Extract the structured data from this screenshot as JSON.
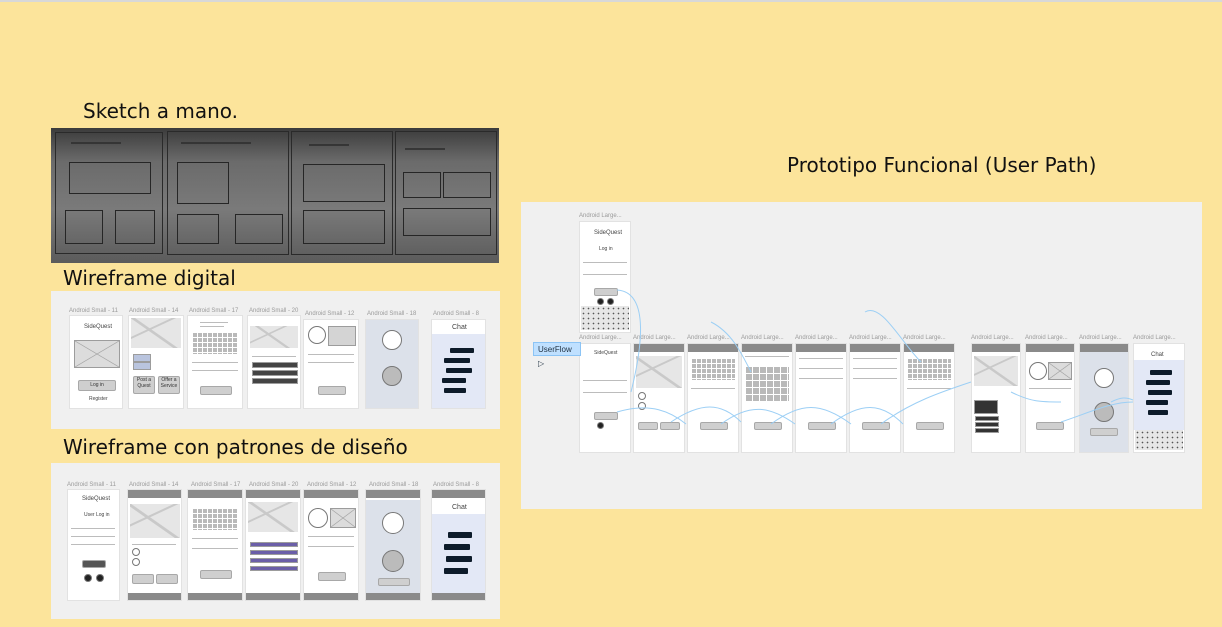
{
  "labels": {
    "sketch": "Sketch a mano.",
    "wireframe": "Wireframe digital",
    "patterns": "Wireframe con patrones de diseño",
    "prototype": "Prototipo Funcional (User Path)"
  },
  "prototype": {
    "user_flow_tag": "UserFlow",
    "frame_title": "Android Large...",
    "login": {
      "app_name": "SideQuest",
      "heading": "Log in",
      "button": "Log in"
    },
    "chat_title": "Chat"
  },
  "wireframe": {
    "frame_titles": [
      "Android Small - 11",
      "Android Small - 14",
      "Android Small - 17",
      "Android Small - 20",
      "Android Small - 12",
      "Android Small - 18",
      "Android Small - 8"
    ],
    "app_name": "SideQuest",
    "login_button": "Log in",
    "register_link": "Register",
    "post_quest": "Post a Quest",
    "offer_service": "Offer a Service",
    "chat_title": "Chat"
  },
  "patterns": {
    "frame_titles": [
      "Android Small - 11",
      "Android Small - 14",
      "Android Small - 17",
      "Android Small - 20",
      "Android Small - 12",
      "Android Small - 18",
      "Android Small - 8"
    ],
    "app_name": "SideQuest",
    "heading": "User Log in",
    "chat_title": "Chat"
  },
  "colors": {
    "background": "#fce49b",
    "panel": "#f0f0f0",
    "flow_lines": "#9ccff5",
    "chat_bubble": "#0d1b2a"
  }
}
